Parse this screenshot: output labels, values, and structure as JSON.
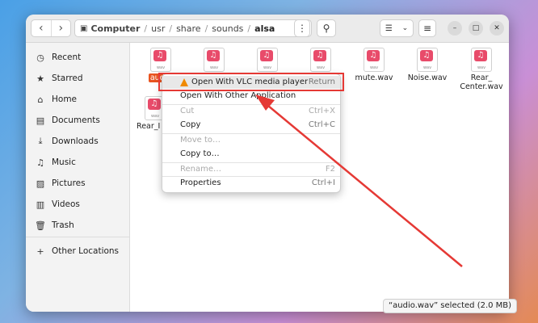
{
  "headerbar": {
    "path": [
      "Computer",
      "usr",
      "share",
      "sounds",
      "alsa"
    ]
  },
  "sidebar": {
    "items": [
      {
        "label": "Recent",
        "icon": "clock-icon"
      },
      {
        "label": "Starred",
        "icon": "star-icon"
      },
      {
        "label": "Home",
        "icon": "home-icon"
      },
      {
        "label": "Documents",
        "icon": "document-icon"
      },
      {
        "label": "Downloads",
        "icon": "download-icon"
      },
      {
        "label": "Music",
        "icon": "music-icon"
      },
      {
        "label": "Pictures",
        "icon": "picture-icon"
      },
      {
        "label": "Videos",
        "icon": "video-icon"
      },
      {
        "label": "Trash",
        "icon": "trash-icon"
      },
      {
        "label": "Other Locations",
        "icon": "plus-icon"
      }
    ]
  },
  "files": [
    {
      "name": "audio",
      "ext": "wav",
      "selected": true
    },
    {
      "name": "",
      "ext": "wav"
    },
    {
      "name": "",
      "ext": "wav"
    },
    {
      "name": "",
      "ext": "wav"
    },
    {
      "name": "mute.wav",
      "ext": "wav"
    },
    {
      "name": "Noise.wav",
      "ext": "wav"
    },
    {
      "name": "Rear_ Center.wav",
      "ext": "wav"
    },
    {
      "name": "Rear_I wa",
      "ext": "wav"
    }
  ],
  "context_menu": {
    "items": [
      {
        "label": "Open With VLC media player",
        "shortcut": "Return",
        "enabled": true
      },
      {
        "label": "Open With Other Application",
        "shortcut": "",
        "enabled": true
      },
      {
        "label": "Cut",
        "shortcut": "Ctrl+X",
        "enabled": false
      },
      {
        "label": "Copy",
        "shortcut": "Ctrl+C",
        "enabled": true
      },
      {
        "label": "Move to…",
        "shortcut": "",
        "enabled": false
      },
      {
        "label": "Copy to…",
        "shortcut": "",
        "enabled": true
      },
      {
        "label": "Rename…",
        "shortcut": "F2",
        "enabled": false
      },
      {
        "label": "Properties",
        "shortcut": "Ctrl+I",
        "enabled": true
      }
    ]
  },
  "status": "“audio.wav” selected (2.0 MB)",
  "colors": {
    "accent": "#e95420",
    "annotation": "#e53935",
    "file_icon": "#e84b6a"
  }
}
